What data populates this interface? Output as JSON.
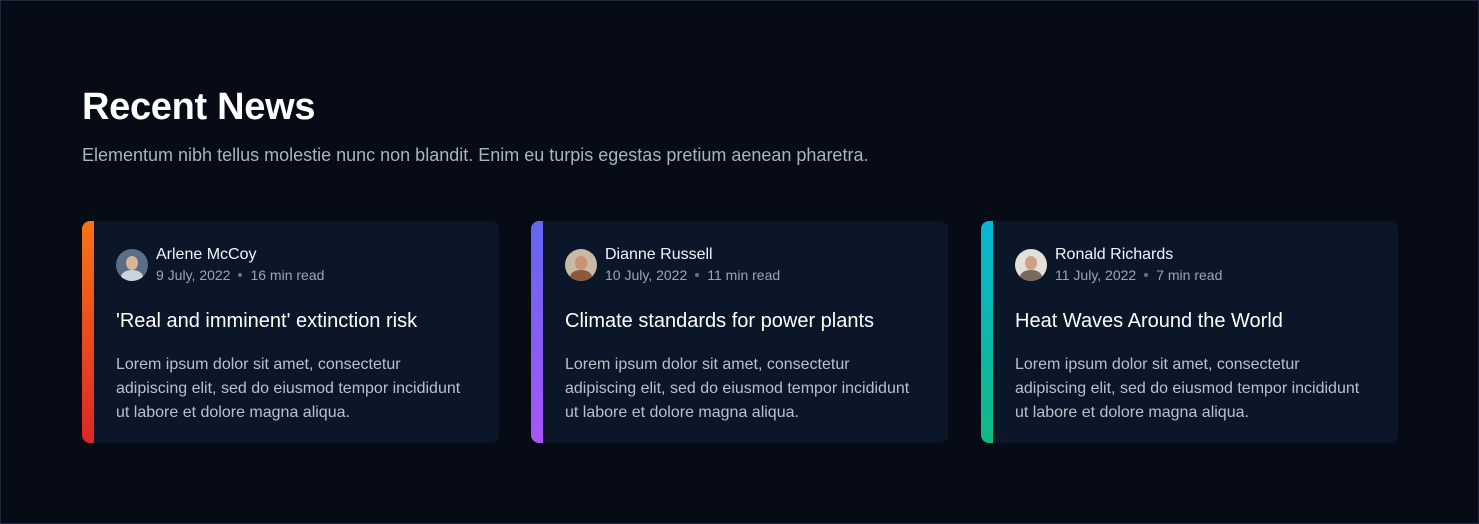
{
  "header": {
    "title": "Recent News",
    "subtitle": "Elementum nibh tellus molestie nunc non blandit. Enim eu turpis egestas pretium aenean pharetra."
  },
  "posts": [
    {
      "author": "Arlene McCoy",
      "date": "9 July, 2022",
      "read_time": "16 min read",
      "title": "'Real and imminent' extinction risk",
      "excerpt": "Lorem ipsum dolor sit amet, consectetur adipiscing elit, sed do eiusmod tempor incididunt ut labore et dolore magna aliqua.",
      "accent_colors": [
        "#f97316",
        "#dc2626"
      ]
    },
    {
      "author": "Dianne Russell",
      "date": "10 July, 2022",
      "read_time": "11 min read",
      "title": "Climate standards for power plants",
      "excerpt": "Lorem ipsum dolor sit amet, consectetur adipiscing elit, sed do eiusmod tempor incididunt ut labore et dolore magna aliqua.",
      "accent_colors": [
        "#6366f1",
        "#a855f7"
      ]
    },
    {
      "author": "Ronald Richards",
      "date": "11 July, 2022",
      "read_time": "7 min read",
      "title": "Heat Waves Around the World",
      "excerpt": "Lorem ipsum dolor sit amet, consectetur adipiscing elit, sed do eiusmod tempor incididunt ut labore et dolore magna aliqua.",
      "accent_colors": [
        "#06b6d4",
        "#10b981"
      ]
    }
  ],
  "colors": {
    "background": "#060b16",
    "card": "#0b1628"
  }
}
